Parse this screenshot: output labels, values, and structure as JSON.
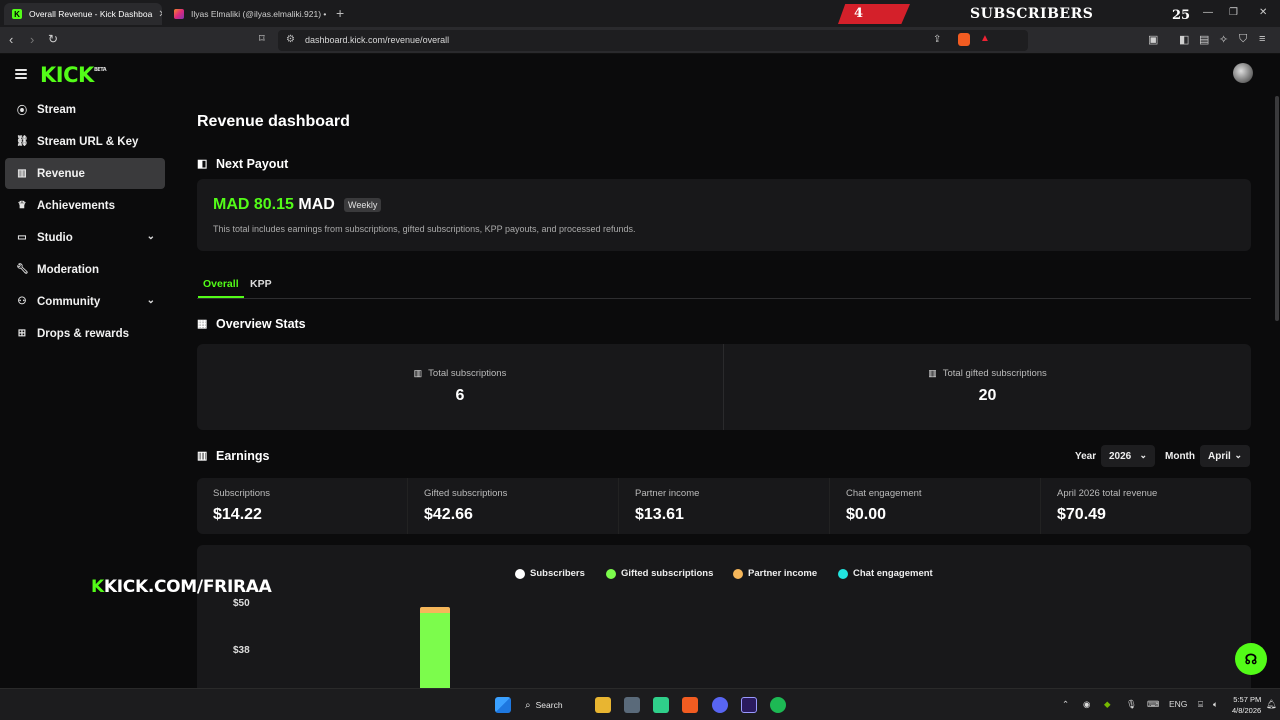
{
  "browser": {
    "tabs": [
      {
        "title": "Overall Revenue - Kick Dashboa",
        "active": true
      },
      {
        "title": "Ilyas Elmaliki (@ilyas.elmaliki.921) • I",
        "active": false
      }
    ],
    "url": "dashboard.kick.com/revenue/overall"
  },
  "stream_overlay": {
    "sub_count_left": "4",
    "label": "SUBSCRIBERS",
    "sub_count_right": "25",
    "channel_text": "KICK.COM/FRIRAA"
  },
  "sidebar": {
    "items": [
      {
        "label": "Stream",
        "icon": "broadcast-icon"
      },
      {
        "label": "Stream URL & Key",
        "icon": "link-icon"
      },
      {
        "label": "Revenue",
        "icon": "chart-icon",
        "active": true
      },
      {
        "label": "Achievements",
        "icon": "trophy-icon"
      },
      {
        "label": "Studio",
        "icon": "studio-icon",
        "expandable": true
      },
      {
        "label": "Moderation",
        "icon": "wrench-icon"
      },
      {
        "label": "Community",
        "icon": "people-icon",
        "expandable": true
      },
      {
        "label": "Drops & rewards",
        "icon": "gift-icon"
      }
    ]
  },
  "main": {
    "title": "Revenue dashboard",
    "next_payout": {
      "heading": "Next Payout",
      "amount": "MAD 80.15",
      "currency": "MAD",
      "badge": "Weekly",
      "note": "This total includes earnings from subscriptions, gifted subscriptions, KPP payouts, and processed refunds."
    },
    "tabs": [
      {
        "label": "Overall",
        "active": true
      },
      {
        "label": "KPP",
        "active": false
      }
    ],
    "overview": {
      "heading": "Overview Stats",
      "stats": [
        {
          "label": "Total subscriptions",
          "value": "6"
        },
        {
          "label": "Total gifted subscriptions",
          "value": "20"
        }
      ]
    },
    "earnings": {
      "heading": "Earnings",
      "year_label": "Year",
      "year_value": "2026",
      "month_label": "Month",
      "month_value": "April",
      "cells": [
        {
          "label": "Subscriptions",
          "value": "$14.22"
        },
        {
          "label": "Gifted subscriptions",
          "value": "$42.66"
        },
        {
          "label": "Partner income",
          "value": "$13.61"
        },
        {
          "label": "Chat engagement",
          "value": "$0.00"
        },
        {
          "label": "April 2026 total revenue",
          "value": "$70.49"
        }
      ]
    }
  },
  "chart_data": {
    "type": "bar",
    "stacked": true,
    "series": [
      {
        "name": "Subscribers",
        "color": "#ffffff"
      },
      {
        "name": "Gifted subscriptions",
        "color": "#7cfc4c"
      },
      {
        "name": "Partner income",
        "color": "#f5b65a"
      },
      {
        "name": "Chat engagement",
        "color": "#22e5e0"
      }
    ],
    "y_ticks_visible": [
      "$50",
      "$38"
    ],
    "visible_bar": {
      "gifted_subscriptions": 42.66,
      "partner_income": 1.5
    }
  },
  "taskbar": {
    "search_label": "Search",
    "language": "ENG",
    "time": "5:57 PM",
    "date": "4/8/2026"
  },
  "colors": {
    "accent": "#53fc18",
    "background": "#0b0b0c",
    "card": "#18181a"
  }
}
